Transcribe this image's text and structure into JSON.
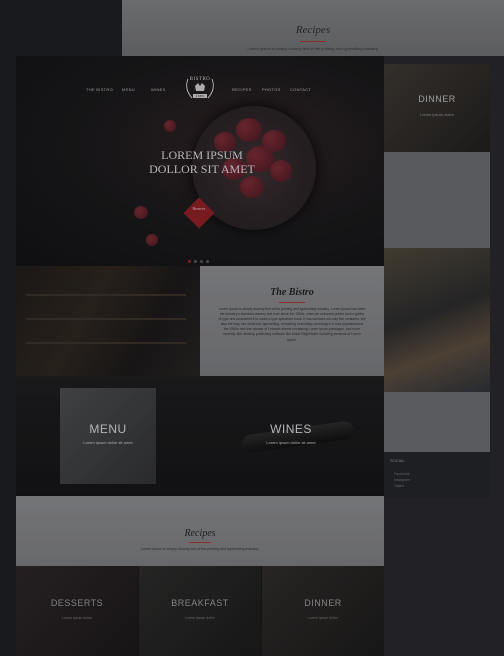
{
  "background": {
    "recipes": {
      "title": "Recipes",
      "subtitle": "Lorem Ipsum is simply dummy text of the printing and typesetting industry."
    },
    "dinner": {
      "title": "DINNER",
      "subtitle": "Lorem ipsum dollor"
    },
    "footer": {
      "heading": "SOCIAL",
      "links": [
        "Facebook",
        "Instagram",
        "Twitter"
      ]
    }
  },
  "nav": {
    "left": [
      "THE BISTRO",
      "MENU",
      "WINES"
    ],
    "right": [
      "RECIPES",
      "PHOTOS",
      "CONTACT"
    ],
    "logo_text": "BISTRO",
    "logo_badge": "1986"
  },
  "hero": {
    "title_line1": "LOREM IPSUM",
    "title_line2": "DOLLOR SIT AMET",
    "button_label": "Reserve"
  },
  "about": {
    "title": "The Bistro",
    "paragraph": "Lorem Ipsum is simply dummy text of the printing and typesetting industry. Lorem Ipsum has been the industry's standard dummy text ever since the 1500s, when an unknown printer took a galley of type and scrambled it to make a type specimen book. It has survived not only five centuries, but also the leap into electronic typesetting, remaining essentially unchanged. It was popularised in the 1960s with the release of Letraset sheets containing Lorem Ipsum passages, and more recently with desktop publishing software like Aldus PageMaker including versions of Lorem Ipsum."
  },
  "tiles": {
    "menu": {
      "title": "MENU",
      "subtitle": "Lorem ipsum dollor sit amet"
    },
    "wines": {
      "title": "WINES",
      "subtitle": "Lorem ipsum dollor sit amet"
    }
  },
  "recipes": {
    "title": "Recipes",
    "subtitle": "Lorem Ipsum is simply dummy text of the printing and typesetting industry."
  },
  "categories": [
    {
      "title": "DESSERTS",
      "subtitle": "Lorem ipsum dollor"
    },
    {
      "title": "BREAKFAST",
      "subtitle": "Lorem ipsum dollor"
    },
    {
      "title": "DINNER",
      "subtitle": "Lorem ipsum dollor"
    }
  ],
  "colors": {
    "accent": "#8e1e24",
    "card_gray": "#8a8b8d",
    "page_bg": "#1c1d1f"
  }
}
